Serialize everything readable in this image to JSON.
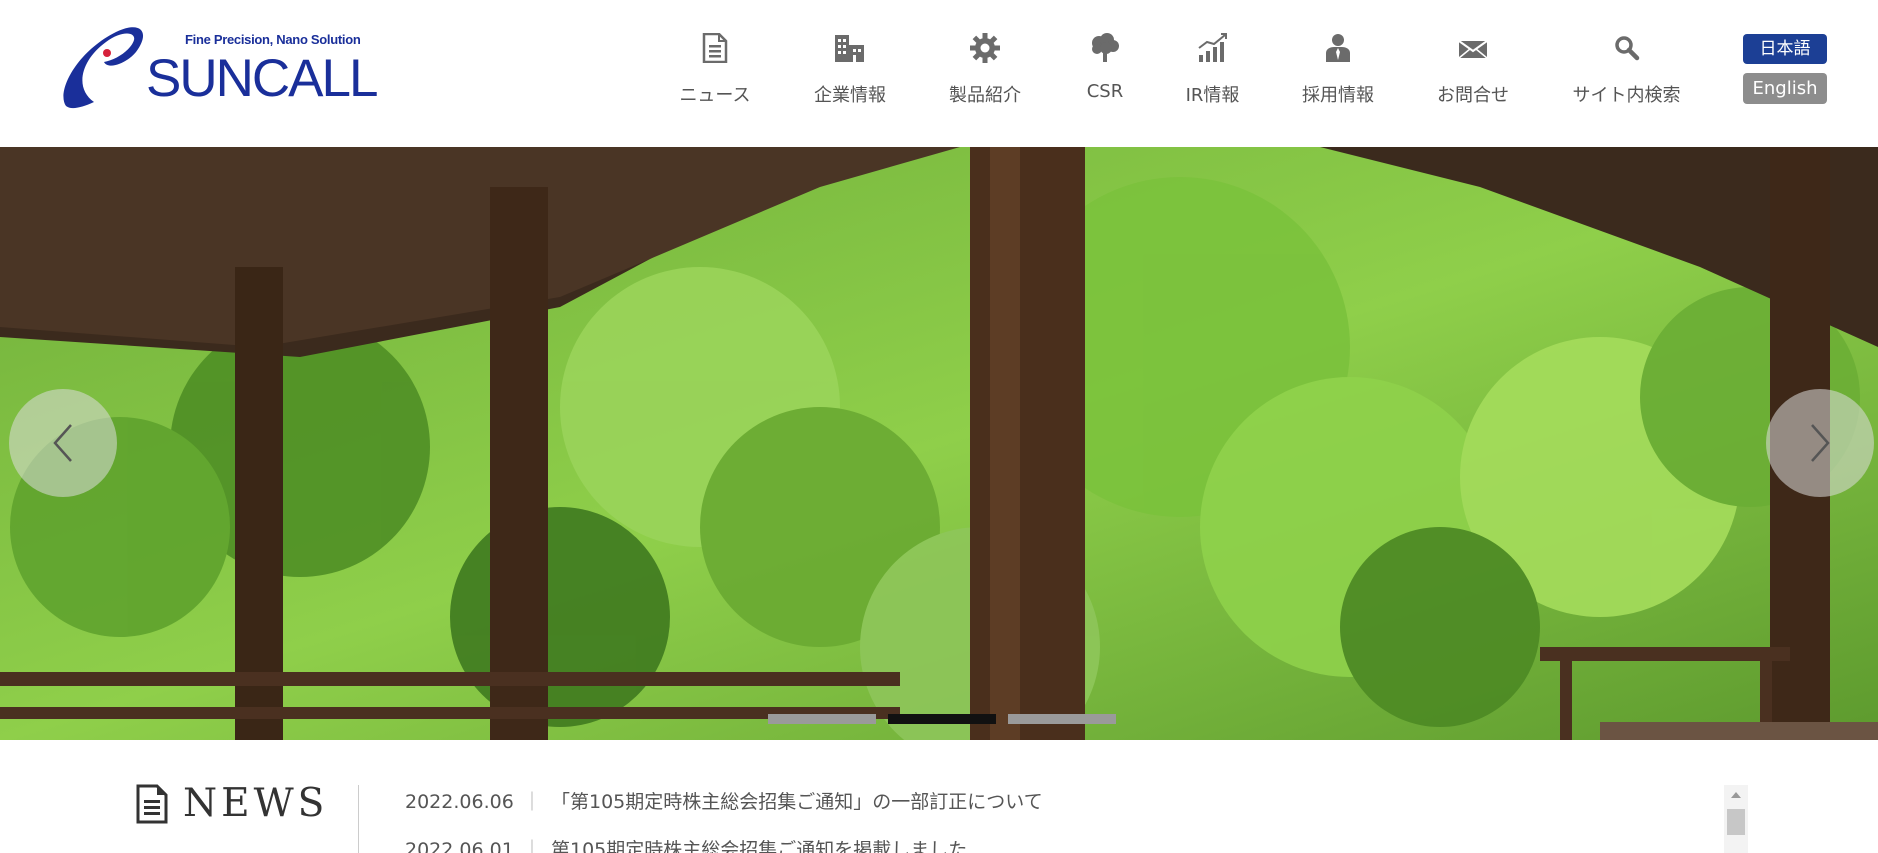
{
  "brand": {
    "tagline": "Fine Precision, Nano Solution",
    "name": "SUNCALL",
    "color": "#1a2f9a",
    "accent_red": "#d6213b"
  },
  "nav": {
    "items": [
      {
        "label": "ニュース",
        "icon": "document-icon"
      },
      {
        "label": "企業情報",
        "icon": "building-icon"
      },
      {
        "label": "製品紹介",
        "icon": "gear-icon"
      },
      {
        "label": "CSR",
        "icon": "tree-icon"
      },
      {
        "label": "IR情報",
        "icon": "chart-icon"
      },
      {
        "label": "採用情報",
        "icon": "person-icon"
      },
      {
        "label": "お問合せ",
        "icon": "envelope-icon"
      },
      {
        "label": "サイト内検索",
        "icon": "search-icon"
      }
    ],
    "icon_color": "#6b6b6b"
  },
  "language": {
    "japanese": "日本語",
    "english": "English",
    "active_color": "#1c3f95",
    "inactive_color": "#8d8d8d"
  },
  "slider": {
    "slide_count": 3,
    "active_index": 1,
    "prev_icon": "chevron-left-icon",
    "next_icon": "chevron-right-icon"
  },
  "news": {
    "heading": "NEWS",
    "items": [
      {
        "date": "2022.06.06",
        "separator": "｜",
        "title": "「第105期定時株主総会招集ご通知」の一部訂正について"
      },
      {
        "date": "2022.06.01",
        "separator": "｜",
        "title": "第105期定時株主総会招集ご通知を掲載しました"
      }
    ]
  }
}
